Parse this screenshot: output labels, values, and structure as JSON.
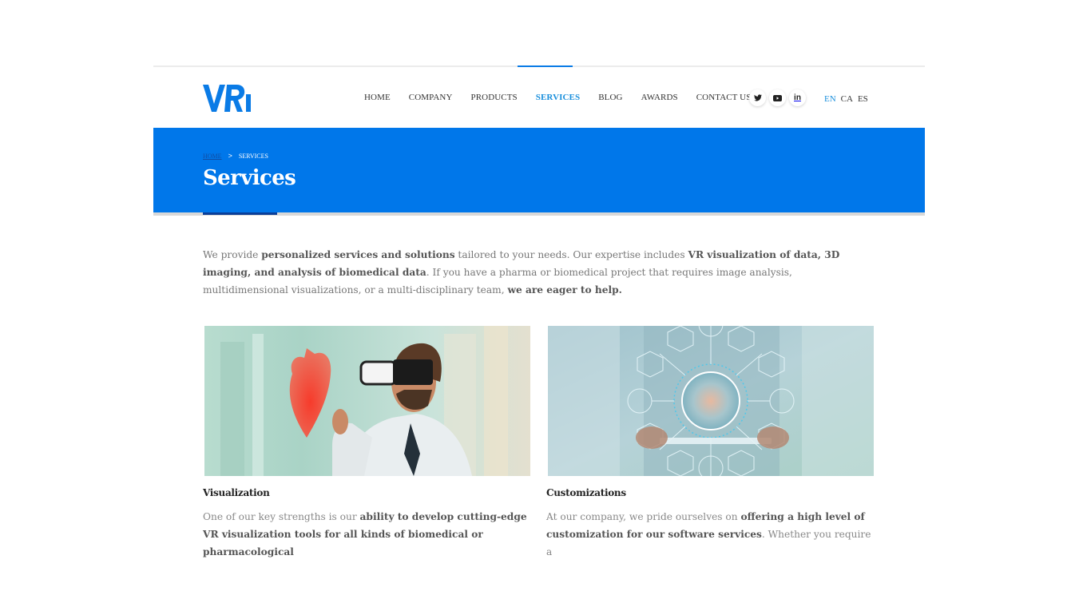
{
  "header": {
    "logo_text": "VRi",
    "nav": [
      {
        "label": "HOME",
        "active": false
      },
      {
        "label": "COMPANY",
        "active": false
      },
      {
        "label": "PRODUCTS",
        "active": false
      },
      {
        "label": "SERVICES",
        "active": true
      },
      {
        "label": "BLOG",
        "active": false
      },
      {
        "label": "AWARDS",
        "active": false
      },
      {
        "label": "CONTACT US",
        "active": false
      }
    ],
    "social": [
      "twitter-icon",
      "youtube-icon",
      "linkedin-icon"
    ],
    "languages": [
      {
        "label": "EN",
        "active": true
      },
      {
        "label": "CA",
        "active": false
      },
      {
        "label": "ES",
        "active": false
      }
    ]
  },
  "banner": {
    "breadcrumb": {
      "home": "HOME",
      "separator": ">",
      "current": "SERVICES"
    },
    "title": "Services"
  },
  "intro": {
    "parts": [
      {
        "t": "We provide ",
        "b": false
      },
      {
        "t": "personalized services and solutions",
        "b": true
      },
      {
        "t": " tailored to your needs. Our expertise includes ",
        "b": false
      },
      {
        "t": "VR visualization of data, 3D imaging, and analysis of biomedical data",
        "b": true
      },
      {
        "t": ". If you have a pharma or biomedical project that requires image analysis, multidimensional visualizations, or a multi-disciplinary team, ",
        "b": false
      },
      {
        "t": "we are eager to help.",
        "b": true
      }
    ]
  },
  "cards": [
    {
      "title": "Visualization",
      "image_alt": "Doctor wearing VR headset touching a holographic heart",
      "parts": [
        {
          "t": "One of our key strengths is our ",
          "b": false
        },
        {
          "t": "ability to develop cutting-edge VR visualization tools for all kinds of biomedical or pharmacological",
          "b": true
        }
      ]
    },
    {
      "title": "Customizations",
      "image_alt": "Doctor holding tablet with holographic medical icons",
      "parts": [
        {
          "t": "At our company, we pride ourselves on ",
          "b": false
        },
        {
          "t": "offering a high level of customization for our software services",
          "b": true
        },
        {
          "t": ". Whether you require a",
          "b": false
        }
      ]
    }
  ],
  "colors": {
    "brand_blue": "#0077ea",
    "nav_active": "#1a8fdc",
    "banner_accent": "#0a3e98"
  }
}
